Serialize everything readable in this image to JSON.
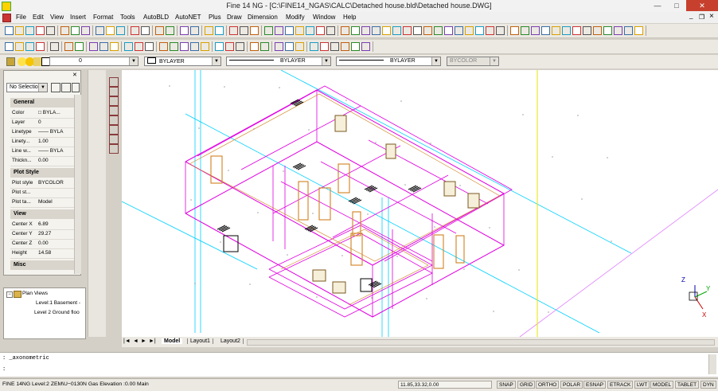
{
  "window": {
    "title": "Fine 14 NG  - [C:\\FINE14_NGAS\\CALC\\Detached house.bld\\Detached house.DWG]",
    "minimize": "—",
    "maximize": "□",
    "close": "✕",
    "doc_minimize": "_",
    "doc_restore": "❐",
    "doc_close": "×"
  },
  "menu": [
    "File",
    "Edit",
    "View",
    "Insert",
    "Format",
    "Tools",
    "AutoBLD",
    "AutoNET",
    "Plus",
    "Draw",
    "Dimension",
    "Modify",
    "Window",
    "Help"
  ],
  "layer_bar": {
    "layer": "0",
    "color": "BYLAYER",
    "linetype": "BYLAYER",
    "lineweight": "BYLAYER",
    "plotstyle": "BYCOLOR"
  },
  "properties": {
    "selection": "No Selectio",
    "sections": {
      "general": "General",
      "plot_style": "Plot Style",
      "view": "View",
      "misc": "Misc"
    },
    "general": [
      {
        "k": "Color",
        "v": "□ BYLA..."
      },
      {
        "k": "Layer",
        "v": "0"
      },
      {
        "k": "Linetype",
        "v": "—— BYLA"
      },
      {
        "k": "Linety...",
        "v": "1.00"
      },
      {
        "k": "Line w...",
        "v": "—— BYLA"
      },
      {
        "k": "Thickn...",
        "v": "0.00"
      }
    ],
    "plot_style": [
      {
        "k": "Plot style",
        "v": "BYCOLOR"
      },
      {
        "k": "Plot st...",
        "v": ""
      },
      {
        "k": "Plot ta...",
        "v": "Model"
      }
    ],
    "view": [
      {
        "k": "Center X",
        "v": "6.89"
      },
      {
        "k": "Center Y",
        "v": "29.27"
      },
      {
        "k": "Center Z",
        "v": "0.00"
      },
      {
        "k": "Height",
        "v": "14.58"
      }
    ]
  },
  "tree": {
    "root": "Plan Views",
    "items": [
      "Level:1 Basement -",
      "Level 2 Ground floo"
    ]
  },
  "tabs": {
    "nav": [
      "|◄",
      "◄",
      "►",
      "►|"
    ],
    "items": [
      "Model",
      "Layout1",
      "Layout2"
    ],
    "active": "Model"
  },
  "command": {
    "line1": ": _axonometric",
    "line2": ":"
  },
  "status": {
    "left": "FINE 14NG Level:2 ZEM\\U−0130N Gas Elevation :0.00 Main",
    "coords": "11.85,33.32,0.00",
    "toggles": [
      "SNAP",
      "GRID",
      "ORTHO",
      "POLAR",
      "ESNAP",
      "ETRACK",
      "LWT",
      "MODEL",
      "TABLET",
      "DYN"
    ]
  },
  "axes": {
    "x": "X",
    "y": "Y",
    "z": "Z"
  },
  "colors": {
    "accent_magenta": "#e000e0",
    "cyan": "#00d0ff",
    "orange": "#d08020",
    "yellow": "#e6e600"
  }
}
